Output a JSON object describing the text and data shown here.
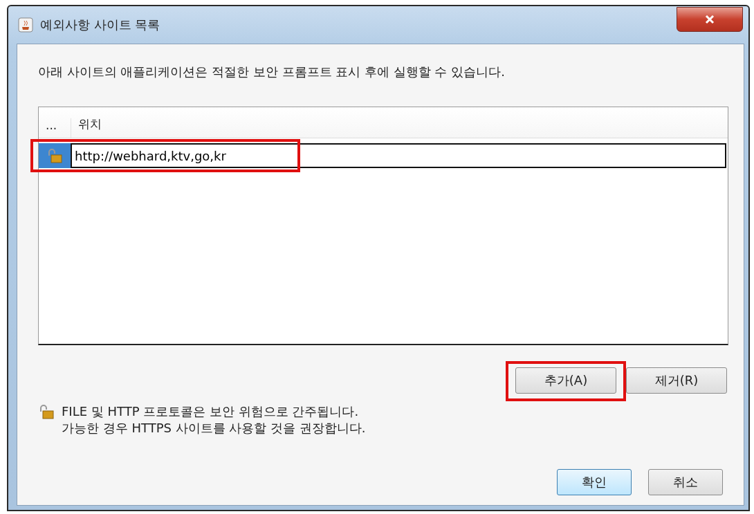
{
  "window": {
    "title": "예외사항 사이트 목록"
  },
  "description": "아래 사이트의 애플리케이션은 적절한 보안 프롬프트 표시 후에 실행할 수 있습니다.",
  "table": {
    "columns": [
      "...",
      "위치"
    ],
    "rows": [
      {
        "location": "http://webhard,ktv,go,kr",
        "selected": true,
        "editing": true,
        "highlighted": true
      }
    ]
  },
  "list_buttons": [
    {
      "label": "추가(A)",
      "highlighted": true
    },
    {
      "label": "제거(R)",
      "highlighted": false
    }
  ],
  "note": [
    "FILE 및 HTTP 프로토콜은 보안 위험으로 간주됩니다.",
    "가능한 경우 HTTPS 사이트를 사용할 것을 권장합니다."
  ],
  "buttons": [
    {
      "label": "확인",
      "default": true
    },
    {
      "label": "취소",
      "default": false
    }
  ]
}
